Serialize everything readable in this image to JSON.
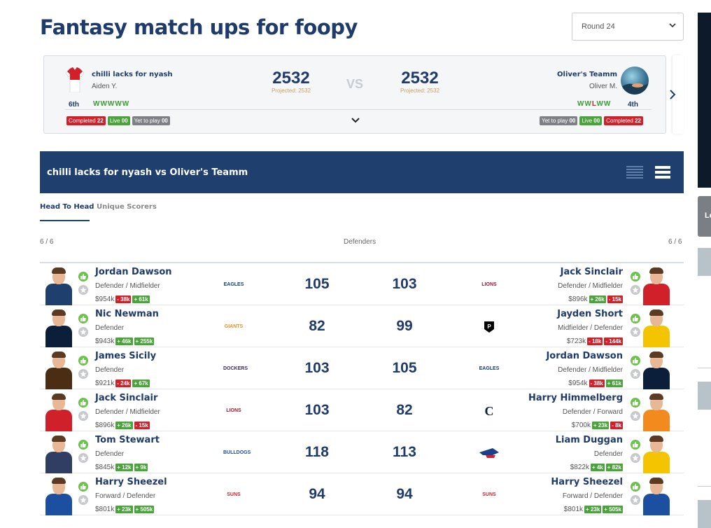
{
  "page": {
    "title": "Fantasy match ups for foopy"
  },
  "round_select": {
    "value": "Round 24"
  },
  "matchup": {
    "left": {
      "team": "chilli lacks for nyash",
      "owner": "Aiden Y.",
      "rank": "6th",
      "form": "WWWWW",
      "score": "2532",
      "projected": "Projected: 2532",
      "badges": [
        {
          "label": "Completed",
          "count": "22",
          "color": "red"
        },
        {
          "label": "Live",
          "count": "00",
          "color": "green"
        },
        {
          "label": "Yet to play",
          "count": "00",
          "color": "grey"
        }
      ]
    },
    "vs": "VS",
    "right": {
      "team": "Oliver's Teamm",
      "owner": "Oliver M.",
      "rank": "4th",
      "form_a": "WW",
      "form_l": "L",
      "form_b": "WW",
      "score": "2532",
      "projected": "Projected: 2532",
      "badges": [
        {
          "label": "Yet to play",
          "count": "00",
          "color": "grey"
        },
        {
          "label": "Live",
          "count": "00",
          "color": "green"
        },
        {
          "label": "Completed",
          "count": "22",
          "color": "red"
        }
      ]
    }
  },
  "banner": {
    "title": "chilli lacks for nyash vs Oliver's Teamm"
  },
  "tabs": {
    "head_to_head": "Head To Head",
    "unique": "Unique Scorers"
  },
  "section": {
    "label": "Defenders",
    "count_left": "6 / 6",
    "count_right": "6 / 6"
  },
  "rows": [
    {
      "left": {
        "name": "Jordan Dawson",
        "pos": "Defender / Midfielder",
        "price": "$954k",
        "chg1": "- 38k",
        "chg2": "+ 61k",
        "club": "EAGLES"
      },
      "ls": "105",
      "rs": "103",
      "right": {
        "name": "Jack Sinclair",
        "pos": "Defender / Midfielder",
        "price": "$896k",
        "chg1": "+ 26k",
        "chg2": "- 15k",
        "club": "LIONS"
      }
    },
    {
      "left": {
        "name": "Nic Newman",
        "pos": "Defender",
        "price": "$943k",
        "chg1": "+ 46k",
        "chg2": "+ 255k",
        "club": "GIANTS"
      },
      "ls": "82",
      "rs": "99",
      "right": {
        "name": "Jayden Short",
        "pos": "Midfielder / Defender",
        "price": "$723k",
        "chg1": "- 18k",
        "chg2": "- 144k",
        "club": "P"
      }
    },
    {
      "left": {
        "name": "James Sicily",
        "pos": "Defender",
        "price": "$921k",
        "chg1": "- 24k",
        "chg2": "+ 67k",
        "club": "DOCKERS"
      },
      "ls": "103",
      "rs": "105",
      "right": {
        "name": "Jordan Dawson",
        "pos": "Defender / Midfielder",
        "price": "$954k",
        "chg1": "- 38k",
        "chg2": "+ 61k",
        "club": "EAGLES"
      }
    },
    {
      "left": {
        "name": "Jack Sinclair",
        "pos": "Defender / Midfielder",
        "price": "$896k",
        "chg1": "+ 26k",
        "chg2": "- 15k",
        "club": "LIONS"
      },
      "ls": "103",
      "rs": "82",
      "right": {
        "name": "Harry Himmelberg",
        "pos": "Defender / Forward",
        "price": "$700k",
        "chg1": "+ 23k",
        "chg2": "- 8k",
        "club": "C"
      }
    },
    {
      "left": {
        "name": "Tom Stewart",
        "pos": "Defender",
        "price": "$845k",
        "chg1": "+ 12k",
        "chg2": "+ 9k",
        "club": "BULLDOGS"
      },
      "ls": "118",
      "rs": "113",
      "right": {
        "name": "Liam Duggan",
        "pos": "Defender",
        "price": "$822k",
        "chg1": "+ 4k",
        "chg2": "+ 82k",
        "club": "CROWS"
      }
    },
    {
      "left": {
        "name": "Harry Sheezel",
        "pos": "Forward / Defender",
        "price": "$801k",
        "chg1": "+ 23k",
        "chg2": "+ 505k",
        "club": "SUNS"
      },
      "ls": "94",
      "rs": "94",
      "right": {
        "name": "Harry Sheezel",
        "pos": "Forward / Defender",
        "price": "$801k",
        "chg1": "+ 23k",
        "chg2": "+ 505k",
        "club": "SUNS"
      }
    }
  ],
  "side": {
    "tab_label": "Le"
  }
}
